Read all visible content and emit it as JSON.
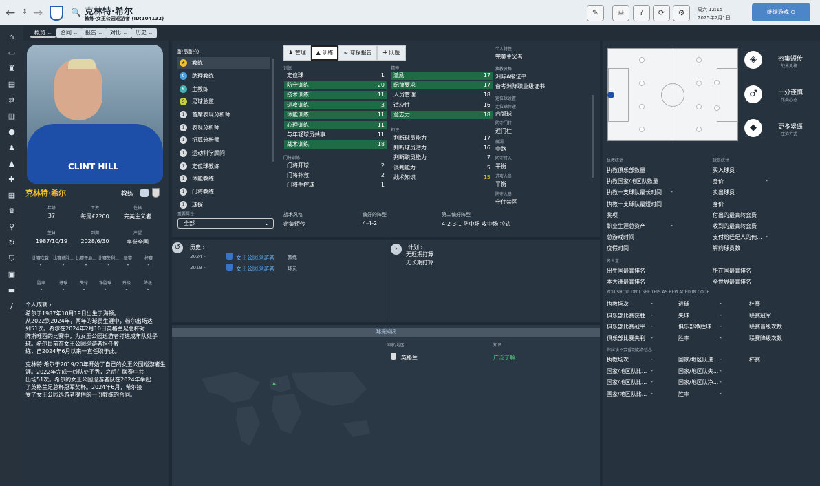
{
  "header": {
    "title": "克林特·希尔",
    "subtitle": "教练-女王公园巡游者 (ID:104132)",
    "day": "周六 12:15",
    "date": "2025年2月1日",
    "continue": "继续游戏"
  },
  "tabs": [
    "概览",
    "合同",
    "报告",
    "对比",
    "历史"
  ],
  "profile": {
    "name": "克林特·希尔",
    "role": "教练",
    "shirt_text": "CLINT HILL",
    "row1": [
      {
        "l": "年龄",
        "v": "37"
      },
      {
        "l": "工资",
        "v": "每周£2200"
      },
      {
        "l": "性格",
        "v": "完美主义者"
      }
    ],
    "row2": [
      {
        "l": "生日",
        "v": "1987/10/19"
      },
      {
        "l": "到期",
        "v": "2028/6/30"
      },
      {
        "l": "声望",
        "v": "享誉全国"
      }
    ],
    "row3": [
      {
        "l": "比赛次数",
        "v": "-"
      },
      {
        "l": "比赛获胜...",
        "v": "-"
      },
      {
        "l": "比赛平局...",
        "v": "-"
      },
      {
        "l": "比赛失利...",
        "v": "-"
      },
      {
        "l": "联赛",
        "v": "-"
      },
      {
        "l": "杯赛",
        "v": "-"
      }
    ],
    "row4": [
      {
        "l": "胜率",
        "v": "-"
      },
      {
        "l": "进球",
        "v": "-"
      },
      {
        "l": "失球",
        "v": "-"
      },
      {
        "l": "净胜球",
        "v": "-"
      },
      {
        "l": "升级",
        "v": "-"
      },
      {
        "l": "降级",
        "v": "-"
      }
    ],
    "achievements_title": "个人成就",
    "bio": [
      "希尔于1987年10月19日出生于海顿。",
      "从2022到2024年，两年的球员生涯中，希尔出场达",
      "到51次。希尔在2024年2月10日英格兰足总杯对",
      "阵斯旺西的比赛中，为女王公园巡游者打进成年队处子",
      "球。希尔目前在女王公园巡游者担任教",
      "练，自2024年6月以来一直任职于此。",
      "",
      "克林特·希尔于2019/20年开始了自己的女王公园巡游者生",
      "涯。2022年完成一线队处子秀，之后在联赛中共",
      "出场51次。希尔的女王公园巡游者队在2024年举起",
      "了英格兰足总杯冠军奖杯。2024年6月，希尔接",
      "受了女王公园巡游者提供的一份教练的合同。"
    ]
  },
  "jobs": {
    "title": "职员职位",
    "items": [
      {
        "n": "★",
        "label": "教练"
      },
      {
        "n": "9",
        "label": "助理教练"
      },
      {
        "n": "6",
        "label": "主教练"
      },
      {
        "n": "5",
        "label": "足球总监"
      },
      {
        "n": "1",
        "label": "首席表现分析师"
      },
      {
        "n": "1",
        "label": "表现分析师"
      },
      {
        "n": "1",
        "label": "招募分析师"
      },
      {
        "n": "1",
        "label": "运动科学顾问"
      },
      {
        "n": "1",
        "label": "定位球教练"
      },
      {
        "n": "1",
        "label": "体能教练"
      },
      {
        "n": "1",
        "label": "门将教练"
      },
      {
        "n": "1",
        "label": "球探"
      }
    ],
    "filter_label": "重要属性:",
    "filter_value": "全部"
  },
  "attr_tabs": [
    "管理",
    "训练",
    "球探报告",
    "队医"
  ],
  "training": {
    "title": "训练",
    "items": [
      {
        "l": "定位球",
        "v": "1",
        "h": false
      },
      {
        "l": "防守训练",
        "v": "20",
        "h": true
      },
      {
        "l": "技术训练",
        "v": "11",
        "h": true
      },
      {
        "l": "进攻训练",
        "v": "3",
        "h": true
      },
      {
        "l": "体能训练",
        "v": "11",
        "h": true
      },
      {
        "l": "心理训练",
        "v": "11",
        "h": true
      },
      {
        "l": "与年轻球员共事",
        "v": "11",
        "h": false
      },
      {
        "l": "战术训练",
        "v": "18",
        "h": true
      }
    ]
  },
  "gk": {
    "title": "门将训练",
    "items": [
      {
        "l": "门将开球",
        "v": "2"
      },
      {
        "l": "门将扑救",
        "v": "2"
      },
      {
        "l": "门将手控球",
        "v": "1"
      }
    ]
  },
  "mental": {
    "title": "精神",
    "items": [
      {
        "l": "激励",
        "v": "17",
        "h": true
      },
      {
        "l": "纪律要求",
        "v": "17",
        "h": true
      },
      {
        "l": "人员管理",
        "v": "18",
        "h": false
      },
      {
        "l": "适应性",
        "v": "16",
        "h": false
      },
      {
        "l": "意志力",
        "v": "18",
        "h": true
      }
    ]
  },
  "knowledge": {
    "title": "知识",
    "items": [
      {
        "l": "判断球员能力",
        "v": "17"
      },
      {
        "l": "判断球员潜力",
        "v": "16"
      },
      {
        "l": "判断职员能力",
        "v": "7"
      },
      {
        "l": "谈判能力",
        "v": "5"
      },
      {
        "l": "战术知识",
        "v": "15"
      }
    ]
  },
  "traits": {
    "title": "个人特性",
    "items": [
      "完美主义者"
    ]
  },
  "badges": {
    "title": "执教资格",
    "items": [
      "洲际A级证书",
      "备考洲际职业级证书"
    ]
  },
  "setpiece": {
    "title": "定位球设置",
    "sub": "定位球传递",
    "v": "内弧球",
    "sub2": "防守门柱",
    "v2": "近门柱",
    "sub3": "藏漏",
    "v3": "中路",
    "sub4": "防守盯人",
    "v4": "平衡",
    "sub5": "进攻人员",
    "v5": "平衡",
    "sub6": "防守人员",
    "v6": "守住禁区"
  },
  "tactics": {
    "l1": "战术风格",
    "v1": "密集短传",
    "l2": "偏好的阵型",
    "v2": "4-4-2",
    "l3": "第二偏好阵型",
    "v3": "4-2-3-1 防中场 攻中场 拉边"
  },
  "history": {
    "title": "历史",
    "rows": [
      {
        "year": "2024 -",
        "club": "女王公园巡游者",
        "role": "教练"
      },
      {
        "year": "2019 -",
        "club": "女王公园巡游者",
        "role": "球员"
      }
    ]
  },
  "plans": {
    "title": "计划",
    "items": [
      "无近期打算",
      "无长期打算"
    ]
  },
  "scout": {
    "title": "球探知识",
    "col1": "国家/地区",
    "col2": "知识",
    "country": "英格兰",
    "level": "广泛了解"
  },
  "style": [
    {
      "t": "密集短传",
      "s": "战术风格"
    },
    {
      "t": "十分谨慎",
      "s": "比赛心态"
    },
    {
      "t": "更多紧逼",
      "s": "压迫方式"
    }
  ],
  "stats": {
    "head1": "执教统计",
    "head2": "球员统计",
    "left": [
      "执教俱乐部数量",
      "执教国家/地区队数量",
      "执教一支球队最长时间",
      "执教一支球队最短时间",
      "奖项",
      "职业生涯总资产",
      "总游戏时间",
      "度假时间"
    ],
    "left_vals": [
      "",
      "",
      "-",
      "",
      "",
      "-",
      "",
      ""
    ],
    "right": [
      "买入球员",
      "身价",
      "卖出球员",
      "身价",
      "付出的最高转会费",
      "收到的最高转会费",
      "支付给经纪人的佣...",
      "解约球员数"
    ],
    "right_vals": [
      "",
      "-",
      "",
      "",
      "",
      "",
      "-",
      ""
    ],
    "fame": "名人堂",
    "fame_rows": [
      [
        "出生国最高排名",
        "所在国最高排名"
      ],
      [
        "本大洲最高排名",
        "全世界最高排名"
      ]
    ],
    "bug": "YOU SHOULDN'T SEE THIS AS REPLACED IN CODE",
    "grid1": [
      [
        "执教场次",
        "-",
        "进球",
        "-",
        "杯赛"
      ],
      [
        "俱乐部比赛获胜",
        "-",
        "失球",
        "-",
        "联赛冠军"
      ],
      [
        "俱乐部比赛战平",
        "-",
        "俱乐部净胜球",
        "-",
        "联赛晋级次数"
      ],
      [
        "俱乐部比赛失利",
        "-",
        "胜率",
        "-",
        "联赛降级次数"
      ]
    ],
    "bug2": "你应该不会看到此条信息",
    "grid2": [
      [
        "执教场次",
        "-",
        "国家/地区队进...",
        "-",
        "杯赛"
      ],
      [
        "国家/地区队比...",
        "-",
        "国家/地区队失...",
        "-",
        ""
      ],
      [
        "国家/地区队比...",
        "-",
        "国家/地区队净...",
        "-",
        ""
      ],
      [
        "国家/地区队比...",
        "-",
        "胜率",
        "-",
        ""
      ]
    ]
  },
  "colors": {
    "accent": "#f0c12a",
    "green": "#1e6b46",
    "bg": "#1e2a36"
  }
}
